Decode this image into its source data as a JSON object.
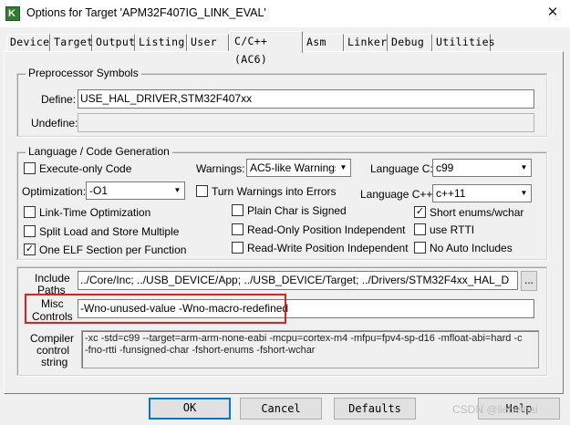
{
  "window": {
    "title": "Options for Target 'APM32F407IG_LINK_EVAL'",
    "close_glyph": "✕"
  },
  "tabs": [
    "Device",
    "Target",
    "Output",
    "Listing",
    "User",
    "C/C++ (AC6)",
    "Asm",
    "Linker",
    "Debug",
    "Utilities"
  ],
  "active_tab": "C/C++ (AC6)",
  "preprocessor": {
    "title": "Preprocessor Symbols",
    "define_label": "Define:",
    "define_value": "USE_HAL_DRIVER,STM32F407xx",
    "undefine_label": "Undefine:",
    "undefine_value": ""
  },
  "language": {
    "title": "Language / Code Generation",
    "execute_only": {
      "label": "Execute-only Code",
      "checked": false
    },
    "warnings_label": "Warnings:",
    "warnings_value": "AC5-like Warnings",
    "language_c_label": "Language C:",
    "language_c_value": "c99",
    "optimization_label": "Optimization:",
    "optimization_value": "-O1",
    "turn_warnings_errors": {
      "label": "Turn Warnings into Errors",
      "checked": false
    },
    "language_cpp_label": "Language C++:",
    "language_cpp_value": "c++11",
    "link_time_opt": {
      "label": "Link-Time Optimization",
      "checked": false
    },
    "plain_char_signed": {
      "label": "Plain Char is Signed",
      "checked": false
    },
    "short_enums": {
      "label": "Short enums/wchar",
      "checked": true
    },
    "split_load_store": {
      "label": "Split Load and Store Multiple",
      "checked": false
    },
    "ro_pos_indep": {
      "label": "Read-Only Position Independent",
      "checked": false
    },
    "use_rtti": {
      "label": "use RTTI",
      "checked": false
    },
    "one_elf_section": {
      "label": "One ELF Section per Function",
      "checked": true
    },
    "rw_pos_indep": {
      "label": "Read-Write Position Independent",
      "checked": false
    },
    "no_auto_includes": {
      "label": "No Auto Includes",
      "checked": false
    }
  },
  "include_paths": {
    "label_line1": "Include",
    "label_line2": "Paths",
    "value": "../Core/Inc;     ../USB_DEVICE/App;     ../USB_DEVICE/Target;     ../Drivers/STM32F4xx_HAL_D",
    "browse_label": "..."
  },
  "misc_controls": {
    "label_line1": "Misc",
    "label_line2": "Controls",
    "value": "-Wno-unused-value -Wno-macro-redefined"
  },
  "compiler_control": {
    "label_line1": "Compiler",
    "label_line2": "control",
    "label_line3": "string",
    "line1": "-xc -std=c99 --target=arm-arm-none-eabi -mcpu=cortex-m4 -mfpu=fpv4-sp-d16 -mfloat-abi=hard -c",
    "line2": "-fno-rtti -funsigned-char -fshort-enums -fshort-wchar"
  },
  "buttons": {
    "ok": "OK",
    "cancel": "Cancel",
    "defaults": "Defaults",
    "help": "Help"
  },
  "watermark": "CSDN @liebeihai",
  "colors": {
    "highlight_border": "#e02020",
    "title_icon": "#2e7d32",
    "button_focus": "#0078d7"
  }
}
